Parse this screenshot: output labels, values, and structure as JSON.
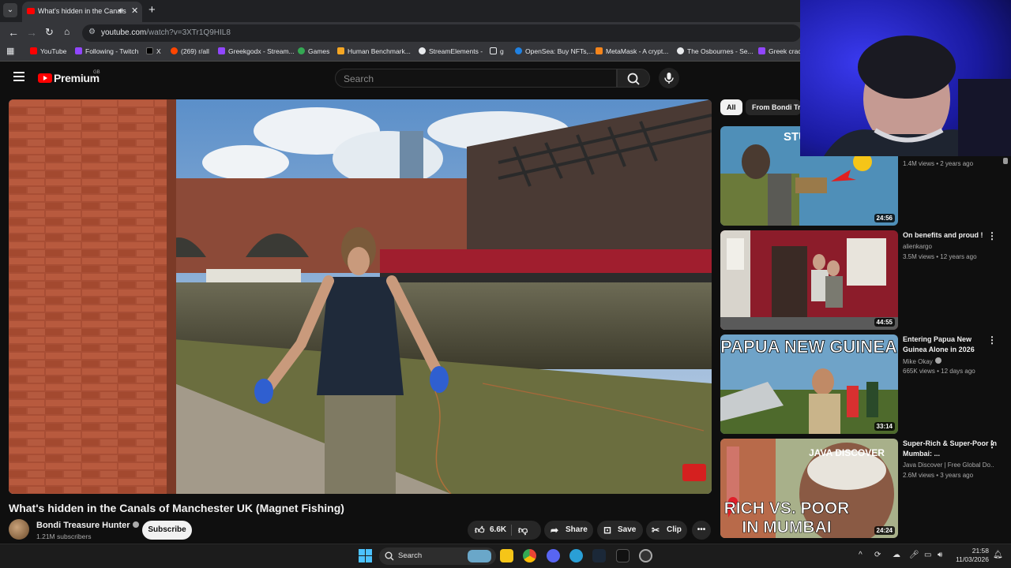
{
  "browser": {
    "tab_title": "What's hidden in the Canals of Manchester UK (Magnet Fishing) - YouTube",
    "new_tab_icon": "plus-icon",
    "url_host": "youtube.com",
    "url_path": "/watch?v=3XTr1Q9HIL8",
    "bookmarks": [
      {
        "label": "YouTube",
        "color": "#ff0000"
      },
      {
        "label": "Following - Twitch",
        "color": "#9146ff"
      },
      {
        "label": "X",
        "color": "#000000"
      },
      {
        "label": "(269) r/all",
        "color": "#ff4500"
      },
      {
        "label": "Greekgodx - Stream...",
        "color": "#9146ff"
      },
      {
        "label": "Games",
        "color": "#34a853"
      },
      {
        "label": "Human Benchmark...",
        "color": "#f5a623"
      },
      {
        "label": "StreamElements -",
        "color": "#e8eaed"
      },
      {
        "label": "g",
        "color": "#e8eaed"
      },
      {
        "label": "OpenSea: Buy NFTs,...",
        "color": "#2081e2"
      },
      {
        "label": "MetaMask - A crypt...",
        "color": "#f6851b"
      },
      {
        "label": "The Osbournes - Se...",
        "color": "#e8eaed"
      },
      {
        "label": "Greek crack",
        "color": "#9146ff"
      }
    ]
  },
  "youtube": {
    "logo_text": "Premium",
    "logo_region": "GB",
    "search_placeholder": "Search"
  },
  "video": {
    "title": "What's hidden in the Canals of Manchester UK (Magnet Fishing)",
    "channel": "Bondi Treasure Hunter",
    "subscribers": "1.21M subscribers",
    "subscribe_label": "Subscribe",
    "likes": "6.6K",
    "share_label": "Share",
    "save_label": "Save",
    "clip_label": "Clip"
  },
  "sidebar": {
    "chips": [
      "All",
      "From Bondi Tre"
    ],
    "items": [
      {
        "title": "",
        "channel": "",
        "meta": "1.4M views • 2 years ago",
        "duration": "24:56"
      },
      {
        "title": "On benefits and proud !",
        "channel": "alienkargo",
        "meta": "3.5M views • 12 years ago",
        "duration": "44:55"
      },
      {
        "title": "Entering Papua New Guinea Alone in 2026",
        "channel": "Mike Okay",
        "meta": "665K views • 12 days ago",
        "duration": "33:14"
      },
      {
        "title": "Super-Rich & Super-Poor in Mumbai: ...",
        "channel": "Java Discover | Free Global Do...",
        "meta": "2.6M views • 3 years ago",
        "duration": "24:24"
      }
    ],
    "thumb_text": {
      "papua": "PAPUA NEW GUINEA",
      "java": "JAVA DISCOVER",
      "rich1": "RICH VS. POOR",
      "rich2": "IN MUMBAI",
      "stu": "STU"
    }
  },
  "taskbar": {
    "search_label": "Search",
    "time": "21:58",
    "date": "11/03/2026"
  }
}
